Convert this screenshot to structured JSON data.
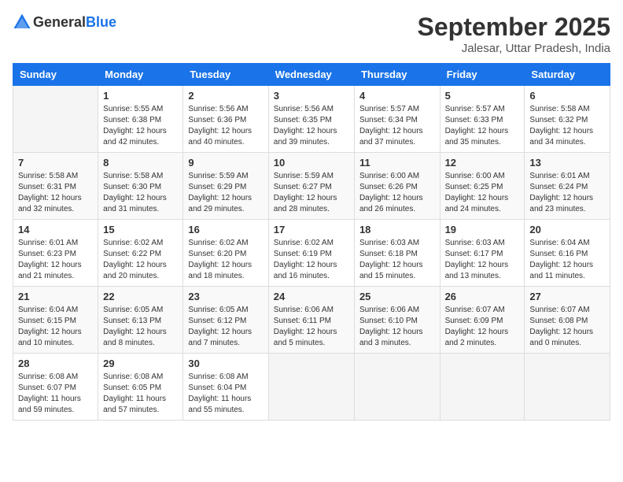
{
  "logo": {
    "text_general": "General",
    "text_blue": "Blue"
  },
  "header": {
    "month": "September 2025",
    "location": "Jalesar, Uttar Pradesh, India"
  },
  "weekdays": [
    "Sunday",
    "Monday",
    "Tuesday",
    "Wednesday",
    "Thursday",
    "Friday",
    "Saturday"
  ],
  "weeks": [
    [
      {
        "day": "",
        "info": ""
      },
      {
        "day": "1",
        "info": "Sunrise: 5:55 AM\nSunset: 6:38 PM\nDaylight: 12 hours\nand 42 minutes."
      },
      {
        "day": "2",
        "info": "Sunrise: 5:56 AM\nSunset: 6:36 PM\nDaylight: 12 hours\nand 40 minutes."
      },
      {
        "day": "3",
        "info": "Sunrise: 5:56 AM\nSunset: 6:35 PM\nDaylight: 12 hours\nand 39 minutes."
      },
      {
        "day": "4",
        "info": "Sunrise: 5:57 AM\nSunset: 6:34 PM\nDaylight: 12 hours\nand 37 minutes."
      },
      {
        "day": "5",
        "info": "Sunrise: 5:57 AM\nSunset: 6:33 PM\nDaylight: 12 hours\nand 35 minutes."
      },
      {
        "day": "6",
        "info": "Sunrise: 5:58 AM\nSunset: 6:32 PM\nDaylight: 12 hours\nand 34 minutes."
      }
    ],
    [
      {
        "day": "7",
        "info": "Sunrise: 5:58 AM\nSunset: 6:31 PM\nDaylight: 12 hours\nand 32 minutes."
      },
      {
        "day": "8",
        "info": "Sunrise: 5:58 AM\nSunset: 6:30 PM\nDaylight: 12 hours\nand 31 minutes."
      },
      {
        "day": "9",
        "info": "Sunrise: 5:59 AM\nSunset: 6:29 PM\nDaylight: 12 hours\nand 29 minutes."
      },
      {
        "day": "10",
        "info": "Sunrise: 5:59 AM\nSunset: 6:27 PM\nDaylight: 12 hours\nand 28 minutes."
      },
      {
        "day": "11",
        "info": "Sunrise: 6:00 AM\nSunset: 6:26 PM\nDaylight: 12 hours\nand 26 minutes."
      },
      {
        "day": "12",
        "info": "Sunrise: 6:00 AM\nSunset: 6:25 PM\nDaylight: 12 hours\nand 24 minutes."
      },
      {
        "day": "13",
        "info": "Sunrise: 6:01 AM\nSunset: 6:24 PM\nDaylight: 12 hours\nand 23 minutes."
      }
    ],
    [
      {
        "day": "14",
        "info": "Sunrise: 6:01 AM\nSunset: 6:23 PM\nDaylight: 12 hours\nand 21 minutes."
      },
      {
        "day": "15",
        "info": "Sunrise: 6:02 AM\nSunset: 6:22 PM\nDaylight: 12 hours\nand 20 minutes."
      },
      {
        "day": "16",
        "info": "Sunrise: 6:02 AM\nSunset: 6:20 PM\nDaylight: 12 hours\nand 18 minutes."
      },
      {
        "day": "17",
        "info": "Sunrise: 6:02 AM\nSunset: 6:19 PM\nDaylight: 12 hours\nand 16 minutes."
      },
      {
        "day": "18",
        "info": "Sunrise: 6:03 AM\nSunset: 6:18 PM\nDaylight: 12 hours\nand 15 minutes."
      },
      {
        "day": "19",
        "info": "Sunrise: 6:03 AM\nSunset: 6:17 PM\nDaylight: 12 hours\nand 13 minutes."
      },
      {
        "day": "20",
        "info": "Sunrise: 6:04 AM\nSunset: 6:16 PM\nDaylight: 12 hours\nand 11 minutes."
      }
    ],
    [
      {
        "day": "21",
        "info": "Sunrise: 6:04 AM\nSunset: 6:15 PM\nDaylight: 12 hours\nand 10 minutes."
      },
      {
        "day": "22",
        "info": "Sunrise: 6:05 AM\nSunset: 6:13 PM\nDaylight: 12 hours\nand 8 minutes."
      },
      {
        "day": "23",
        "info": "Sunrise: 6:05 AM\nSunset: 6:12 PM\nDaylight: 12 hours\nand 7 minutes."
      },
      {
        "day": "24",
        "info": "Sunrise: 6:06 AM\nSunset: 6:11 PM\nDaylight: 12 hours\nand 5 minutes."
      },
      {
        "day": "25",
        "info": "Sunrise: 6:06 AM\nSunset: 6:10 PM\nDaylight: 12 hours\nand 3 minutes."
      },
      {
        "day": "26",
        "info": "Sunrise: 6:07 AM\nSunset: 6:09 PM\nDaylight: 12 hours\nand 2 minutes."
      },
      {
        "day": "27",
        "info": "Sunrise: 6:07 AM\nSunset: 6:08 PM\nDaylight: 12 hours\nand 0 minutes."
      }
    ],
    [
      {
        "day": "28",
        "info": "Sunrise: 6:08 AM\nSunset: 6:07 PM\nDaylight: 11 hours\nand 59 minutes."
      },
      {
        "day": "29",
        "info": "Sunrise: 6:08 AM\nSunset: 6:05 PM\nDaylight: 11 hours\nand 57 minutes."
      },
      {
        "day": "30",
        "info": "Sunrise: 6:08 AM\nSunset: 6:04 PM\nDaylight: 11 hours\nand 55 minutes."
      },
      {
        "day": "",
        "info": ""
      },
      {
        "day": "",
        "info": ""
      },
      {
        "day": "",
        "info": ""
      },
      {
        "day": "",
        "info": ""
      }
    ]
  ]
}
